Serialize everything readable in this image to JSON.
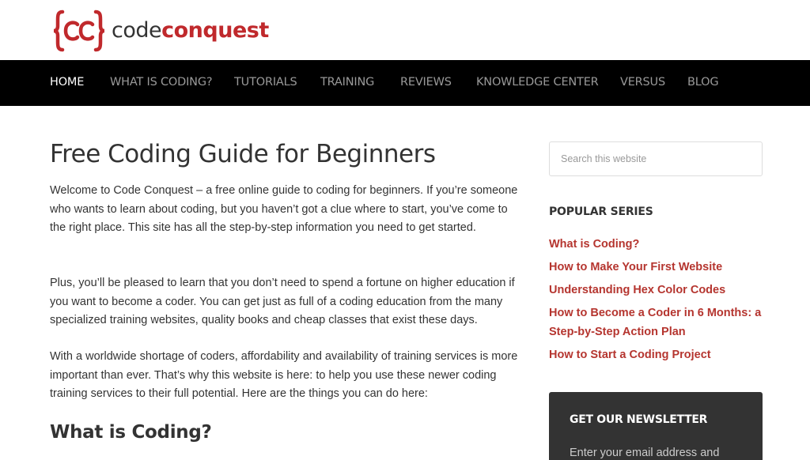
{
  "header": {
    "logo_text_part1": "code",
    "logo_text_part2": "conquest"
  },
  "nav": {
    "items": [
      {
        "label": "HOME",
        "active": true
      },
      {
        "label": "WHAT IS CODING?"
      },
      {
        "label": "TUTORIALS"
      },
      {
        "label": "TRAINING"
      },
      {
        "label": "REVIEWS"
      },
      {
        "label": "KNOWLEDGE CENTER"
      },
      {
        "label": "VERSUS"
      },
      {
        "label": "BLOG"
      }
    ]
  },
  "main": {
    "title": "Free Coding Guide for Beginners",
    "paragraphs": [
      "Welcome to Code Conquest – a free online guide to coding for beginners. If you’re someone who wants to learn about coding, but you haven’t got a clue where to start, you’ve come to the right place. This site has all the step-by-step information you need to get started.",
      "Plus, you’ll be pleased to learn that you don’t need to spend a fortune on higher education if you want to become a coder. You can get just as full of a coding education from the many specialized training websites, quality books and cheap classes that exist these days.",
      "With a worldwide shortage of coders, affordability and availability of training services is more important than ever. That’s why this website is here: to help you use these newer coding training services to their full potential. Here are the things you can do here:"
    ],
    "subtitle": "What is Coding?"
  },
  "sidebar": {
    "search_placeholder": "Search this website",
    "popular_heading": "POPULAR SERIES",
    "series": [
      "What is Coding?",
      "How to Make Your First Website",
      "Understanding Hex Color Codes",
      "How to Become a Coder in 6 Months: a Step-by-Step Action Plan",
      "How to Start a Coding Project"
    ],
    "newsletter_title": "GET OUR NEWSLETTER",
    "newsletter_text": "Enter your email address and"
  },
  "colors": {
    "brand_red": "#c0292c",
    "link_red": "#b5352f",
    "nav_bg": "#000000",
    "newsletter_bg": "#333333"
  }
}
